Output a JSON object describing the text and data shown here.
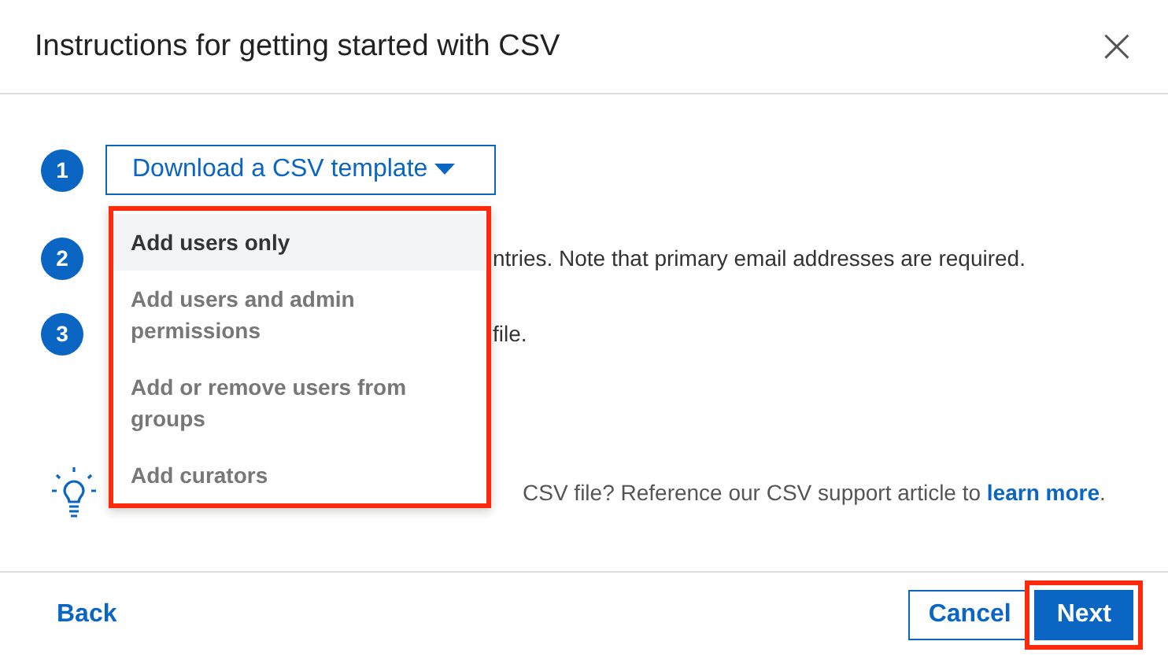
{
  "dialog": {
    "title": "Instructions for getting started with CSV",
    "close": "×"
  },
  "steps": [
    {
      "number": "1",
      "kind": "button",
      "label": "Download a CSV template"
    },
    {
      "number": "2",
      "kind": "text",
      "text": "ntries. Note that primary email addresses are required."
    },
    {
      "number": "3",
      "kind": "text",
      "text": "file."
    }
  ],
  "dropdown": {
    "highlighted": true,
    "items": [
      {
        "label": "Add users only",
        "selected": true
      },
      {
        "label": "Add users and admin permissions",
        "selected": false
      },
      {
        "label": "Add or remove users from groups",
        "selected": false
      },
      {
        "label": "Add curators",
        "selected": false
      }
    ]
  },
  "help": {
    "text": "CSV file? Reference our CSV support article to",
    "link": "learn more",
    "end": "."
  },
  "footer": {
    "back": "Back",
    "cancel": "Cancel",
    "next": {
      "label": "Next",
      "highlighted": true
    }
  }
}
